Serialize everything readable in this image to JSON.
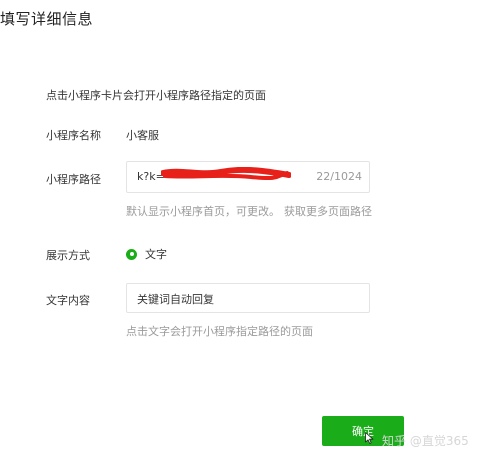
{
  "dialog": {
    "title": "填写详细信息",
    "tip": "点击小程序卡片会打开小程序路径指定的页面"
  },
  "form": {
    "name_label": "小程序名称",
    "name_value": "小客服",
    "path_label": "小程序路径",
    "path_value": "k?k=",
    "path_counter": "22/1024",
    "path_hint_default": "默认显示小程序首页，可更改。",
    "path_hint_link": "获取更多页面路径",
    "display_label": "展示方式",
    "display_option": "文字",
    "text_label": "文字内容",
    "text_value": "关键词自动回复",
    "text_hint": "点击文字会打开小程序指定路径的页面"
  },
  "actions": {
    "confirm_label": "确定"
  },
  "watermark": "知乎 @直觉365",
  "colors": {
    "accent": "#1aad19",
    "redaction": "#e8201a"
  }
}
